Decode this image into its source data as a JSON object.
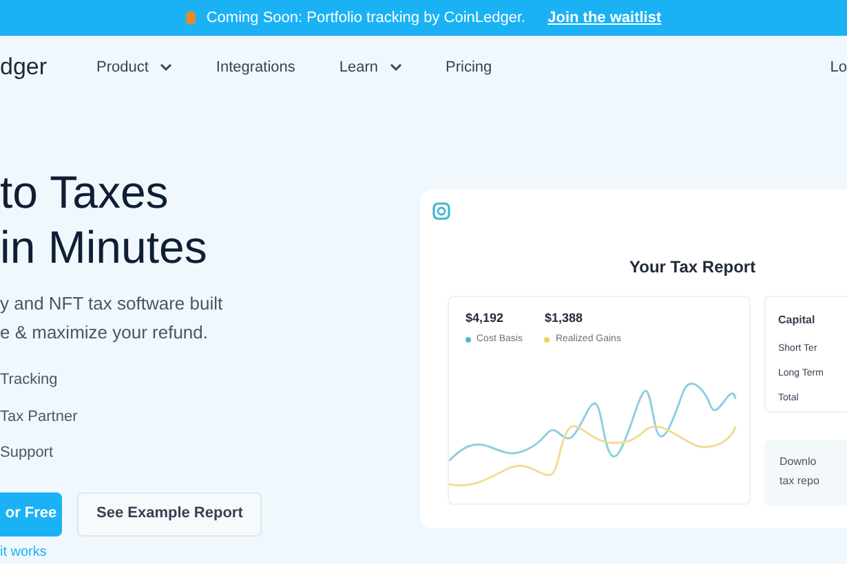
{
  "banner": {
    "text": "Coming Soon: Portfolio tracking by CoinLedger.",
    "link": "Join the waitlist"
  },
  "nav": {
    "logo": "dger",
    "items": [
      {
        "label": "Product",
        "dropdown": true
      },
      {
        "label": "Integrations",
        "dropdown": false
      },
      {
        "label": "Learn",
        "dropdown": true
      },
      {
        "label": "Pricing",
        "dropdown": false
      }
    ],
    "login": "Lo"
  },
  "hero": {
    "heading": [
      "to Taxes",
      "in Minutes"
    ],
    "subtitle": [
      "y and NFT tax software built",
      "e & maximize your refund."
    ],
    "features": [
      "Tracking",
      "Tax Partner",
      "Support"
    ],
    "primary_button": "or Free",
    "secondary_button": "See Example Report",
    "link": "it works"
  },
  "report": {
    "title": "Your Tax Report",
    "stats": [
      {
        "value": "$4,192",
        "label": "Cost Basis",
        "color": "#4fb8d6"
      },
      {
        "value": "$1,388",
        "label": "Realized Gains",
        "color": "#f2cf5b"
      }
    ],
    "summary": {
      "title": "Capital",
      "rows": [
        "Short Ter",
        "Long Term",
        "Total"
      ]
    },
    "download": [
      "Downlo",
      "tax repo"
    ]
  }
}
